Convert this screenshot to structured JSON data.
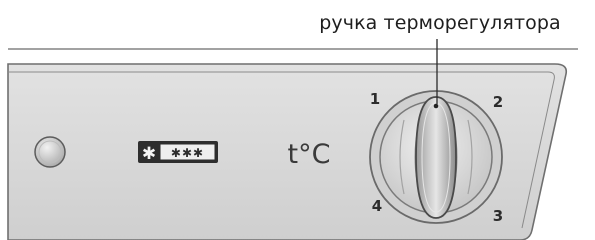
{
  "callout": {
    "label": "ручка терморегулятора"
  },
  "panel": {
    "freezer_badge_symbol": "✱",
    "freezer_badge_stars": "✱✱✱",
    "temperature_label": "t°C"
  },
  "dial": {
    "positions": [
      "1",
      "2",
      "3",
      "4"
    ]
  },
  "colors": {
    "panel_fill": "#d9d9d9",
    "panel_outline": "#6f6f6f",
    "knob_highlight": "#ededed",
    "text": "#1e1e1e"
  }
}
